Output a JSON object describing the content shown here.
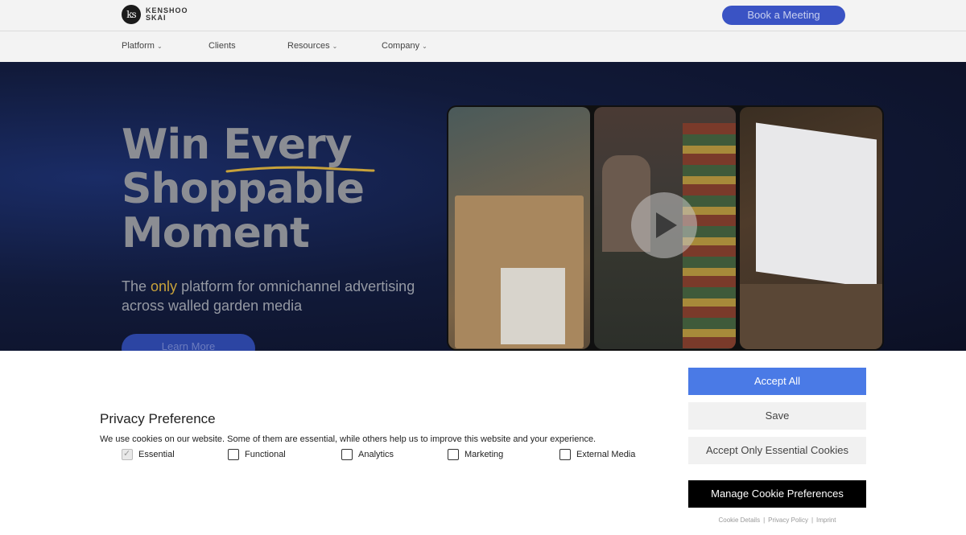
{
  "header": {
    "logo_mark": "ks",
    "logo_line1": "KENSHOO",
    "logo_line2": "SKAI",
    "book_button": "Book a Meeting",
    "nav": [
      {
        "label": "Platform"
      },
      {
        "label": "Clients"
      },
      {
        "label": "Resources"
      },
      {
        "label": "Company"
      }
    ]
  },
  "hero": {
    "title_line1": "Win Every",
    "title_line2": "Shoppable",
    "title_line3": "Moment",
    "subtitle_prefix": "The ",
    "subtitle_highlight": "only",
    "subtitle_rest": " platform for omnichannel advertising across walled garden media",
    "learn_more": "Learn More",
    "accent_color": "#c8a23a"
  },
  "cookie": {
    "title": "Privacy Preference",
    "description": "We use cookies on our website. Some of them are essential, while others help us to improve this website and your experience.",
    "options": [
      {
        "label": "Essential",
        "checked": true,
        "disabled": true
      },
      {
        "label": "Functional",
        "checked": false
      },
      {
        "label": "Analytics",
        "checked": false
      },
      {
        "label": "Marketing",
        "checked": false
      },
      {
        "label": "External Media",
        "checked": false
      }
    ],
    "accept_all": "Accept All",
    "save": "Save",
    "accept_essential": "Accept Only Essential Cookies",
    "manage": "Manage Cookie Preferences",
    "links": [
      "Cookie Details",
      "Privacy Policy",
      "Imprint"
    ],
    "separator": "|",
    "primary_color": "#4a7ae6"
  }
}
